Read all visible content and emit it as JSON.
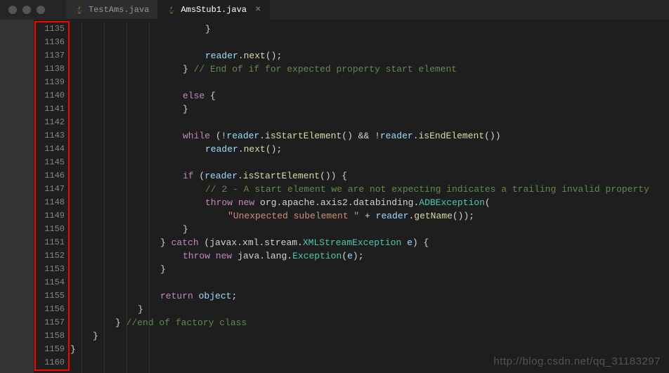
{
  "tabs": [
    {
      "label": "TestAms.java",
      "active": false
    },
    {
      "label": "AmsStub1.java",
      "active": true
    }
  ],
  "gutter": {
    "start": 1135,
    "end": 1160
  },
  "code_lines": [
    [
      {
        "indent": 24,
        "text": "}",
        "cls": "c-punc"
      }
    ],
    [],
    [
      {
        "indent": 24,
        "text": "reader",
        "cls": "c-var"
      },
      {
        "text": ".",
        "cls": "c-punc"
      },
      {
        "text": "next",
        "cls": "c-method"
      },
      {
        "text": "();",
        "cls": "c-punc"
      }
    ],
    [
      {
        "indent": 20,
        "text": "} ",
        "cls": "c-punc"
      },
      {
        "text": "// End of if for expected property start element",
        "cls": "c-comment"
      }
    ],
    [],
    [
      {
        "indent": 20,
        "text": "else",
        "cls": "c-keyword"
      },
      {
        "text": " {",
        "cls": "c-punc"
      }
    ],
    [
      {
        "indent": 20,
        "text": "}",
        "cls": "c-punc"
      }
    ],
    [],
    [
      {
        "indent": 20,
        "text": "while",
        "cls": "c-keyword"
      },
      {
        "text": " (!",
        "cls": "c-punc"
      },
      {
        "text": "reader",
        "cls": "c-var"
      },
      {
        "text": ".",
        "cls": "c-punc"
      },
      {
        "text": "isStartElement",
        "cls": "c-method"
      },
      {
        "text": "() && !",
        "cls": "c-punc"
      },
      {
        "text": "reader",
        "cls": "c-var"
      },
      {
        "text": ".",
        "cls": "c-punc"
      },
      {
        "text": "isEndElement",
        "cls": "c-method"
      },
      {
        "text": "())",
        "cls": "c-punc"
      }
    ],
    [
      {
        "indent": 24,
        "text": "reader",
        "cls": "c-var"
      },
      {
        "text": ".",
        "cls": "c-punc"
      },
      {
        "text": "next",
        "cls": "c-method"
      },
      {
        "text": "();",
        "cls": "c-punc"
      }
    ],
    [],
    [
      {
        "indent": 20,
        "text": "if",
        "cls": "c-keyword"
      },
      {
        "text": " (",
        "cls": "c-punc"
      },
      {
        "text": "reader",
        "cls": "c-var"
      },
      {
        "text": ".",
        "cls": "c-punc"
      },
      {
        "text": "isStartElement",
        "cls": "c-method"
      },
      {
        "text": "()) {",
        "cls": "c-punc"
      }
    ],
    [
      {
        "indent": 24,
        "text": "// 2 - A start element we are not expecting indicates a trailing invalid property",
        "cls": "c-comment"
      }
    ],
    [
      {
        "indent": 24,
        "text": "throw",
        "cls": "c-keyword"
      },
      {
        "text": " ",
        "cls": "c-punc"
      },
      {
        "text": "new",
        "cls": "c-new"
      },
      {
        "text": " org.apache.axis2.databinding.",
        "cls": "c-ns"
      },
      {
        "text": "ADBException",
        "cls": "c-type"
      },
      {
        "text": "(",
        "cls": "c-punc"
      }
    ],
    [
      {
        "indent": 28,
        "text": "\"Unexpected subelement \"",
        "cls": "c-string"
      },
      {
        "text": " + ",
        "cls": "c-punc"
      },
      {
        "text": "reader",
        "cls": "c-var"
      },
      {
        "text": ".",
        "cls": "c-punc"
      },
      {
        "text": "getName",
        "cls": "c-method"
      },
      {
        "text": "());",
        "cls": "c-punc"
      }
    ],
    [
      {
        "indent": 20,
        "text": "}",
        "cls": "c-punc"
      }
    ],
    [
      {
        "indent": 16,
        "text": "} ",
        "cls": "c-punc"
      },
      {
        "text": "catch",
        "cls": "c-keyword"
      },
      {
        "text": " (javax.xml.stream.",
        "cls": "c-ns"
      },
      {
        "text": "XMLStreamException",
        "cls": "c-type"
      },
      {
        "text": " ",
        "cls": "c-punc"
      },
      {
        "text": "e",
        "cls": "c-var"
      },
      {
        "text": ") {",
        "cls": "c-punc"
      }
    ],
    [
      {
        "indent": 20,
        "text": "throw",
        "cls": "c-keyword"
      },
      {
        "text": " ",
        "cls": "c-punc"
      },
      {
        "text": "new",
        "cls": "c-new"
      },
      {
        "text": " java.lang.",
        "cls": "c-ns"
      },
      {
        "text": "Exception",
        "cls": "c-type"
      },
      {
        "text": "(",
        "cls": "c-punc"
      },
      {
        "text": "e",
        "cls": "c-var"
      },
      {
        "text": ");",
        "cls": "c-punc"
      }
    ],
    [
      {
        "indent": 16,
        "text": "}",
        "cls": "c-punc"
      }
    ],
    [],
    [
      {
        "indent": 16,
        "text": "return",
        "cls": "c-keyword"
      },
      {
        "text": " ",
        "cls": "c-punc"
      },
      {
        "text": "object",
        "cls": "c-var"
      },
      {
        "text": ";",
        "cls": "c-punc"
      }
    ],
    [
      {
        "indent": 12,
        "text": "}",
        "cls": "c-punc"
      }
    ],
    [
      {
        "indent": 8,
        "text": "} ",
        "cls": "c-punc"
      },
      {
        "text": "//end of factory class",
        "cls": "c-comment"
      }
    ],
    [
      {
        "indent": 4,
        "text": "}",
        "cls": "c-punc"
      }
    ],
    [
      {
        "indent": 0,
        "text": "}",
        "cls": "c-punc"
      }
    ],
    []
  ],
  "indent_guides": [
    16,
    48,
    80,
    112
  ],
  "watermark": "http://blog.csdn.net/qq_31183297"
}
